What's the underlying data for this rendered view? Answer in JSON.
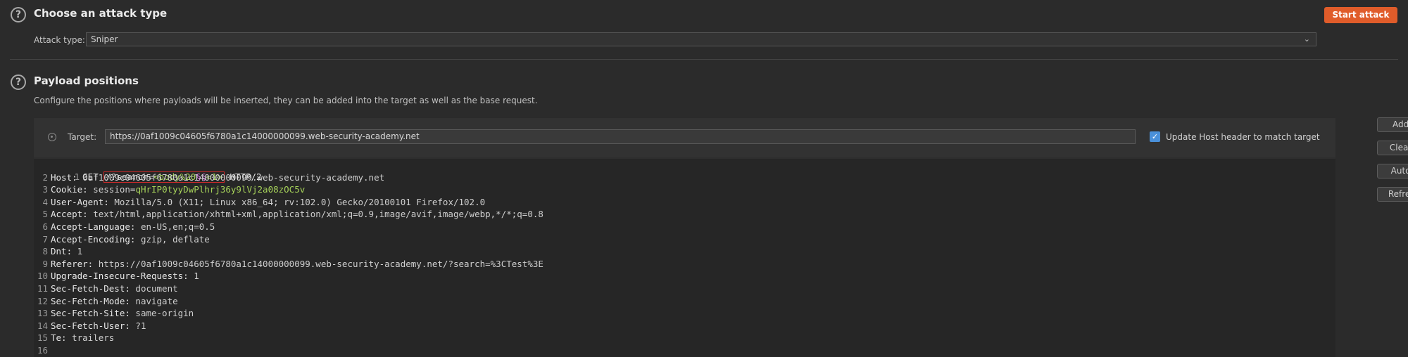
{
  "attack": {
    "title": "Choose an attack type",
    "start_label": "Start attack",
    "type_label": "Attack type:",
    "type_value": "Sniper"
  },
  "positions": {
    "title": "Payload positions",
    "description": "Configure the positions where payloads will be inserted, they can be added into the target as well as the base request.",
    "target_label": "Target:",
    "target_value": "https://0af1009c04605f6780a1c14000000099.web-security-academy.net",
    "update_host_label": "Update Host header to match target",
    "update_host_checked": true,
    "buttons": {
      "add": "Add §",
      "clear": "Clear §",
      "auto": "Auto §",
      "refresh": "Refresh"
    }
  },
  "request": {
    "line1": {
      "method": "GET",
      "path_prefix": "/?search=",
      "payload_pre": "<body%20",
      "marker": "§§",
      "payload_post": "=1>",
      "protocol": "HTTP/2"
    },
    "headers": [
      {
        "num": "2",
        "name": "Host:",
        "value": "0af1009c04605f6780a1c14000000099.web-security-academy.net"
      },
      {
        "num": "3",
        "name": "Cookie:",
        "value": "session=",
        "cookie": "qHrIP0tyyDwPlhrj36y9lVj2a08zOC5v"
      },
      {
        "num": "4",
        "name": "User-Agent:",
        "value": "Mozilla/5.0 (X11; Linux x86_64; rv:102.0) Gecko/20100101 Firefox/102.0"
      },
      {
        "num": "5",
        "name": "Accept:",
        "value": "text/html,application/xhtml+xml,application/xml;q=0.9,image/avif,image/webp,*/*;q=0.8"
      },
      {
        "num": "6",
        "name": "Accept-Language:",
        "value": "en-US,en;q=0.5"
      },
      {
        "num": "7",
        "name": "Accept-Encoding:",
        "value": "gzip, deflate"
      },
      {
        "num": "8",
        "name": "Dnt:",
        "value": "1"
      },
      {
        "num": "9",
        "name": "Referer:",
        "value": "https://0af1009c04605f6780a1c14000000099.web-security-academy.net/?search=%3CTest%3E"
      },
      {
        "num": "10",
        "name": "Upgrade-Insecure-Requests:",
        "value": "1"
      },
      {
        "num": "11",
        "name": "Sec-Fetch-Dest:",
        "value": "document"
      },
      {
        "num": "12",
        "name": "Sec-Fetch-Mode:",
        "value": "navigate"
      },
      {
        "num": "13",
        "name": "Sec-Fetch-Site:",
        "value": "same-origin"
      },
      {
        "num": "14",
        "name": "Sec-Fetch-User:",
        "value": "?1"
      },
      {
        "num": "15",
        "name": "Te:",
        "value": "trailers"
      },
      {
        "num": "16",
        "name": "",
        "value": ""
      }
    ]
  }
}
